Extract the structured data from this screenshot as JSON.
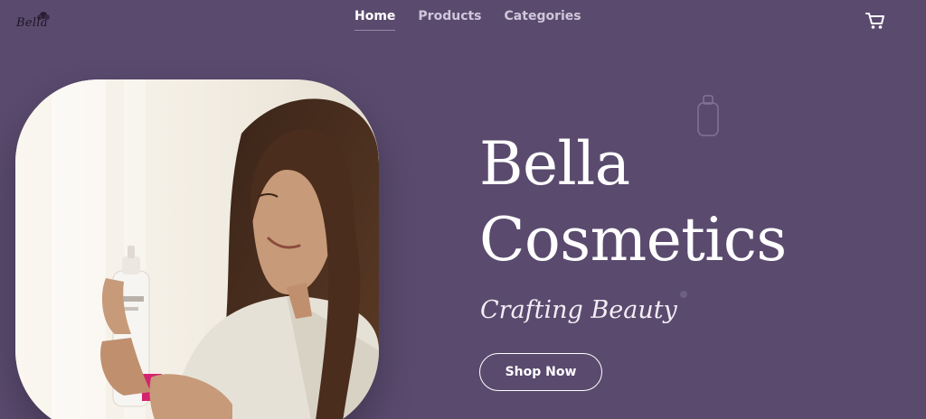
{
  "brand": {
    "logo_text": "Bella"
  },
  "nav": {
    "items": [
      {
        "label": "Home",
        "active": true
      },
      {
        "label": "Products",
        "active": false
      },
      {
        "label": "Categories",
        "active": false
      }
    ],
    "cart_icon": "cart-icon"
  },
  "hero": {
    "title": "Bella Cosmetics",
    "subtitle": "Crafting Beauty",
    "cta_label": "Shop Now",
    "image_alt": "Woman smiling holding a cosmetic spray bottle"
  },
  "colors": {
    "background": "#5a4a6e",
    "text": "#ffffff",
    "nav_inactive": "#cfc6da"
  }
}
